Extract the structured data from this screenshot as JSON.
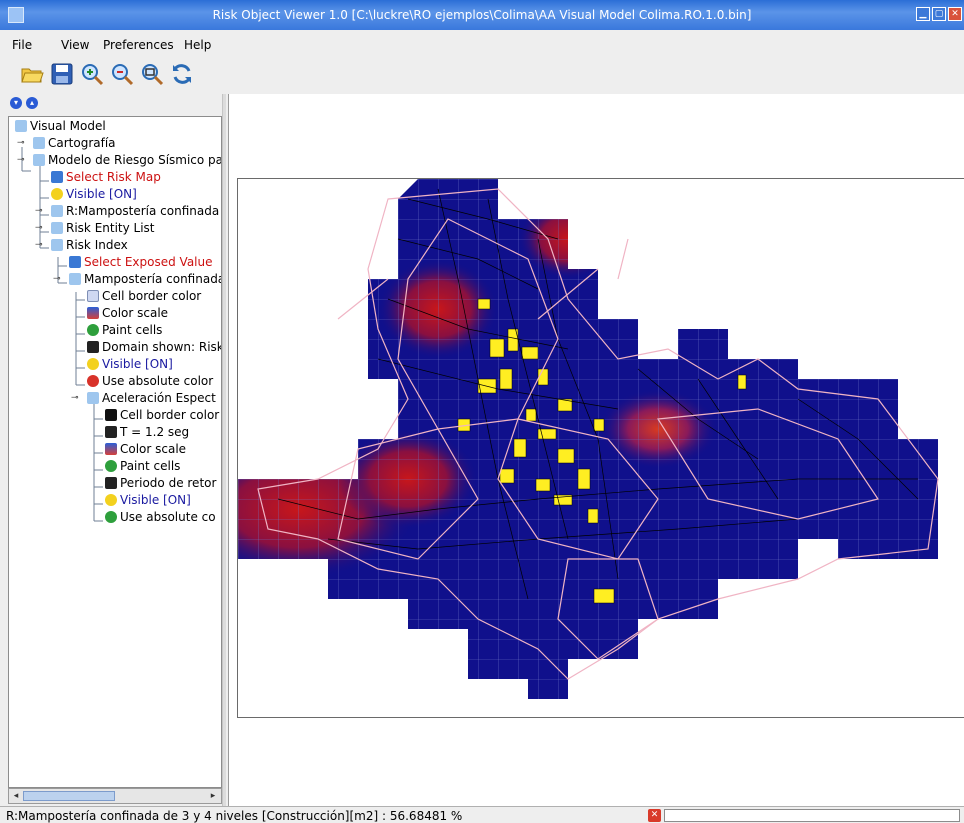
{
  "window": {
    "title": "Risk Object Viewer 1.0 [C:\\luckre\\RO ejemplos\\Colima\\AA Visual Model Colima.RO.1.0.bin]"
  },
  "menu": {
    "items": [
      "File",
      "View",
      "Preferences",
      "Help"
    ]
  },
  "toolbar": {
    "icons": [
      "open-folder-icon",
      "save-disk-icon",
      "zoom-in-icon",
      "zoom-out-icon",
      "zoom-fit-icon",
      "refresh-icon"
    ]
  },
  "tree": {
    "nodes": [
      {
        "label": "Visual Model",
        "style": "normal"
      },
      {
        "label": "Cartografía",
        "style": "normal"
      },
      {
        "label": "Modelo de Riesgo Sísmico pa",
        "style": "normal"
      },
      {
        "label": "Select Risk Map",
        "style": "red"
      },
      {
        "label": "Visible [ON]",
        "style": "blue"
      },
      {
        "label": "R:Mampostería confinada",
        "style": "normal"
      },
      {
        "label": "Risk Entity List",
        "style": "normal"
      },
      {
        "label": "Risk Index",
        "style": "normal"
      },
      {
        "label": "Select Exposed Value",
        "style": "red"
      },
      {
        "label": "Mampostería confinada",
        "style": "normal"
      },
      {
        "label": "Cell border color",
        "style": "normal"
      },
      {
        "label": "Color scale",
        "style": "normal"
      },
      {
        "label": "Paint cells",
        "style": "normal"
      },
      {
        "label": "Domain shown: Risk",
        "style": "normal"
      },
      {
        "label": "Visible [ON]",
        "style": "blue"
      },
      {
        "label": "Use absolute color",
        "style": "normal"
      },
      {
        "label": "Aceleración Espect",
        "style": "normal"
      },
      {
        "label": "Cell border color",
        "style": "normal"
      },
      {
        "label": "T = 1.2 seg",
        "style": "normal"
      },
      {
        "label": "Color scale",
        "style": "normal"
      },
      {
        "label": "Paint cells",
        "style": "normal"
      },
      {
        "label": "Periodo de retor",
        "style": "normal"
      },
      {
        "label": "Visible [ON]",
        "style": "blue"
      },
      {
        "label": "Use absolute co",
        "style": "normal"
      }
    ]
  },
  "statusbar": {
    "text": "R:Mampostería confinada de 3 y 4 niveles [Construcción][m2] : 56.68481 %"
  },
  "colors": {
    "cell": "#0f0f8a",
    "hot": "#c01010",
    "highlight": "#ffee00",
    "border": "#f0b0c0"
  }
}
